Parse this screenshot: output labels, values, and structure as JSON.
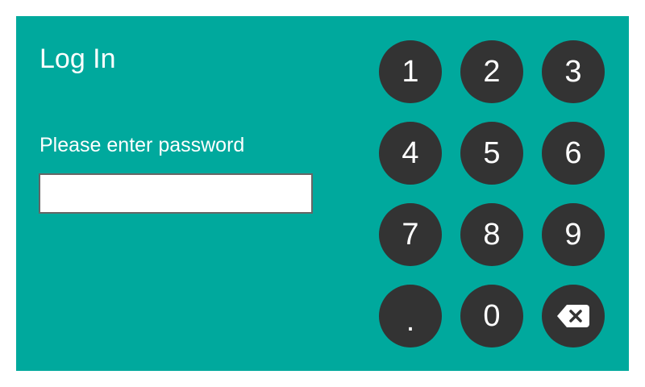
{
  "login": {
    "title": "Log In",
    "prompt": "Please enter password",
    "password_value": "",
    "password_placeholder": ""
  },
  "keypad": {
    "keys": [
      "1",
      "2",
      "3",
      "4",
      "5",
      "6",
      "7",
      "8",
      "9",
      ".",
      "0"
    ],
    "backspace_icon": "backspace-icon"
  },
  "colors": {
    "background": "#00a99d",
    "key": "#333333",
    "text": "#ffffff"
  }
}
